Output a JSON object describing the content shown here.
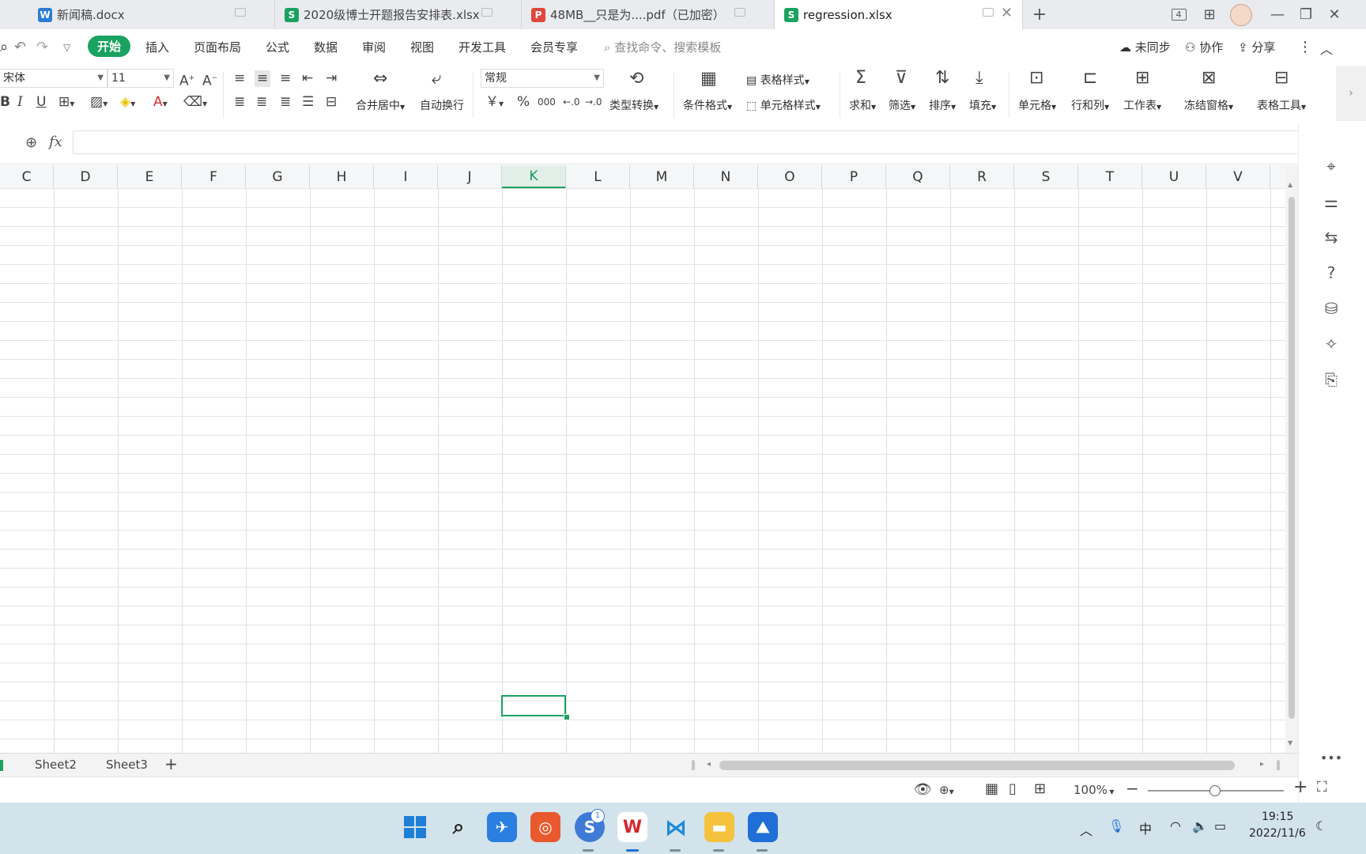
{
  "tabs": [
    {
      "label": "新闻稿.docx",
      "icon": "W",
      "color": "#2b7cd3"
    },
    {
      "label": "2020级博士开题报告安排表.xlsx",
      "icon": "S",
      "color": "#1aa260"
    },
    {
      "label": "48MB__只是为....pdf（已加密）",
      "icon": "P",
      "color": "#e0463c"
    },
    {
      "label": "regression.xlsx",
      "icon": "S",
      "color": "#1aa260",
      "active": true
    }
  ],
  "window": {
    "new_tab": "+",
    "minimize": "—",
    "restore": "❐",
    "close": "✕",
    "badge": "4"
  },
  "menu": {
    "items": [
      "开始",
      "插入",
      "页面布局",
      "公式",
      "数据",
      "审阅",
      "视图",
      "开发工具",
      "会员专享"
    ],
    "active": "开始",
    "search_placeholder": "查找命令、搜索模板",
    "sync": "未同步",
    "collab": "协作",
    "share": "分享"
  },
  "ribbon": {
    "font_name": "宋体",
    "font_size": "11",
    "merge_center": "合并居中",
    "wrap_text": "自动换行",
    "number_format": "常规",
    "type_convert": "类型转换",
    "cond_format": "条件格式",
    "table_style": "表格样式",
    "cell_style": "单元格样式",
    "sum": "求和",
    "filter": "筛选",
    "sort": "排序",
    "fill": "填充",
    "cell": "单元格",
    "row_col": "行和列",
    "worksheet": "工作表",
    "freeze": "冻结窗格",
    "table_tools": "表格工具",
    "currency": "￥",
    "percent": "%",
    "thousands": "000"
  },
  "formula": {
    "fx_label": "fx",
    "value": ""
  },
  "columns": [
    "C",
    "D",
    "E",
    "F",
    "G",
    "H",
    "I",
    "J",
    "K",
    "L",
    "M",
    "N",
    "O",
    "P",
    "Q",
    "R",
    "S",
    "T",
    "U",
    "V"
  ],
  "selected_column": "K",
  "sheets": [
    "Sheet2",
    "Sheet3"
  ],
  "status": {
    "zoom": "100%"
  },
  "taskbar": {
    "time": "19:15",
    "date": "2022/11/6",
    "ime": "中",
    "sogou_badge": "1"
  }
}
